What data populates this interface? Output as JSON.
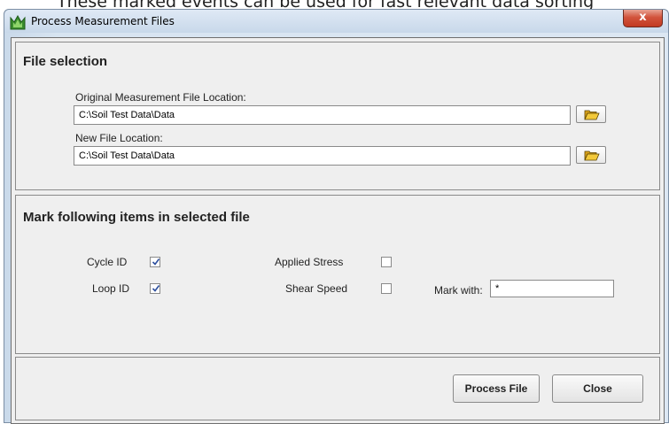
{
  "background": {
    "text": "These marked events can be used for fast relevant data sorting"
  },
  "window": {
    "title": "Process Measurement Files",
    "close_glyph": "x"
  },
  "file_selection": {
    "title": "File selection",
    "original_label": "Original Measurement File Location:",
    "original_value": "C:\\Soil Test Data\\Data",
    "new_label": "New File Location:",
    "new_value": "C:\\Soil Test Data\\Data"
  },
  "mark_items": {
    "title": "Mark following items in selected file",
    "items": [
      {
        "label": "Cycle ID",
        "checked": true
      },
      {
        "label": "Loop ID",
        "checked": true
      },
      {
        "label": "Applied Stress",
        "checked": false
      },
      {
        "label": "Shear Speed",
        "checked": false
      }
    ],
    "mark_with_label": "Mark with:",
    "mark_with_value": "*"
  },
  "buttons": {
    "process": "Process File",
    "close": "Close"
  },
  "icons": {
    "folder": "folder-open-icon",
    "app": "app-icon"
  }
}
